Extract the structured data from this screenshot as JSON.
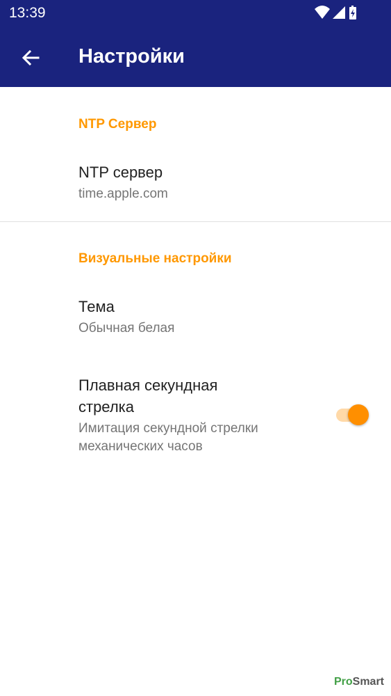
{
  "status_bar": {
    "time": "13:39",
    "icons": [
      "wifi-icon",
      "signal-icon",
      "battery-charging-icon"
    ]
  },
  "app_bar": {
    "title": "Настройки",
    "back_icon": "arrow-back-icon",
    "color": "#1a237e"
  },
  "sections": [
    {
      "header": "NTP Сервер",
      "items": [
        {
          "title": "NTP сервер",
          "summary": "time.apple.com"
        }
      ]
    },
    {
      "header": "Визуальные настройки",
      "items": [
        {
          "title": "Тема",
          "summary": "Обычная белая"
        },
        {
          "title_line1": "Плавная секундная",
          "title_line2": "стрелка",
          "summary_line1": "Имитация секундной стрелки",
          "summary_line2": "механических часов",
          "switch_on": true
        }
      ]
    }
  ],
  "accent_color": "#ff9800",
  "watermark": {
    "part1": "Pro",
    "part2": "Smart"
  }
}
